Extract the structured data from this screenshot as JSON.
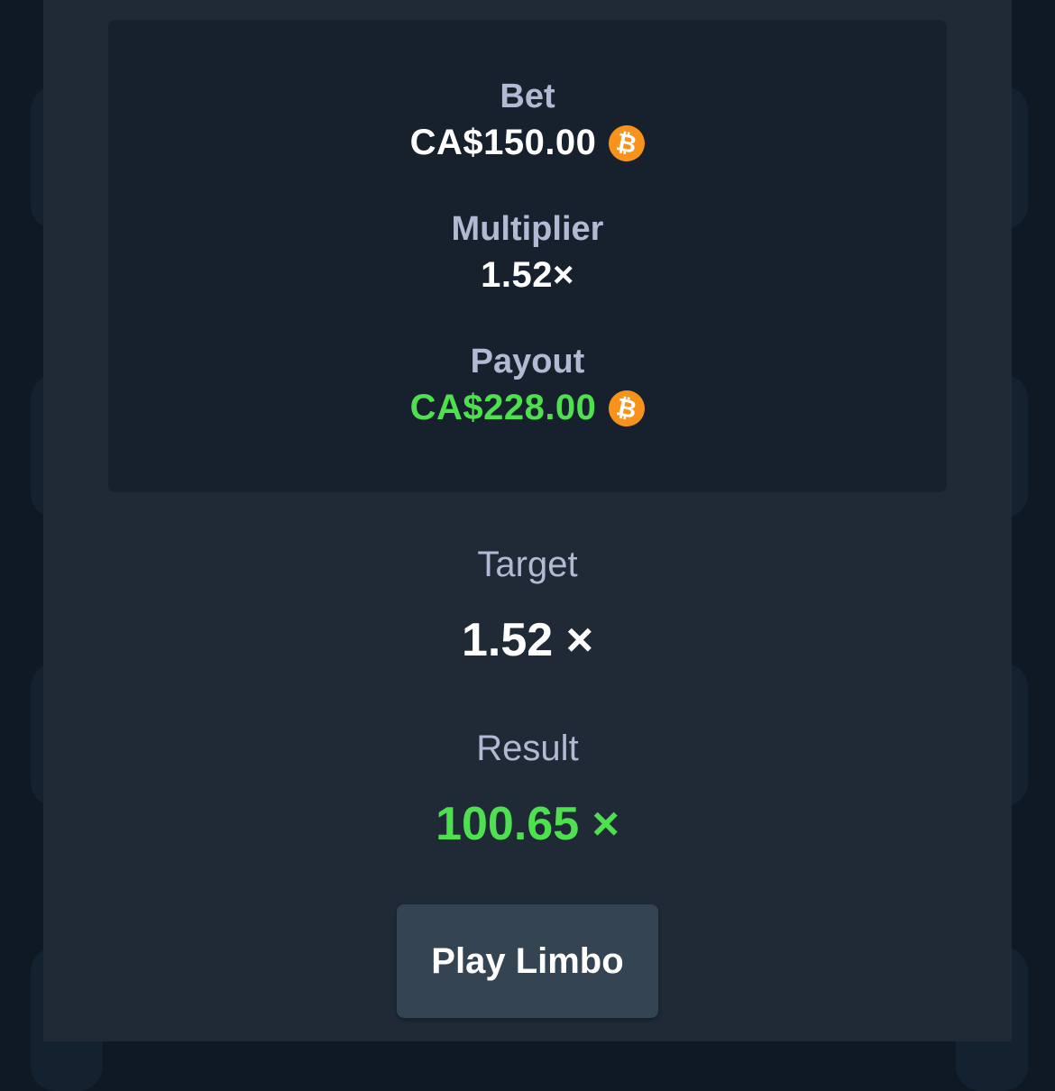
{
  "bet_details": {
    "bet_label": "Bet",
    "bet_value": "CA$150.00",
    "multiplier_label": "Multiplier",
    "multiplier_value": "1.52×",
    "payout_label": "Payout",
    "payout_value": "CA$228.00",
    "currency_icon": "bitcoin-icon",
    "currency_glyph": "₿"
  },
  "target": {
    "label": "Target",
    "value": "1.52 ×"
  },
  "result": {
    "label": "Result",
    "value": "100.65 ×"
  },
  "play_button": {
    "label": "Play Limbo"
  },
  "colors": {
    "background": "#0f1923",
    "modal": "#1f2a36",
    "card": "#16212d",
    "label": "#b1bad3",
    "win_green": "#4fe04f",
    "coin_orange": "#f7931a",
    "button": "#344453"
  }
}
